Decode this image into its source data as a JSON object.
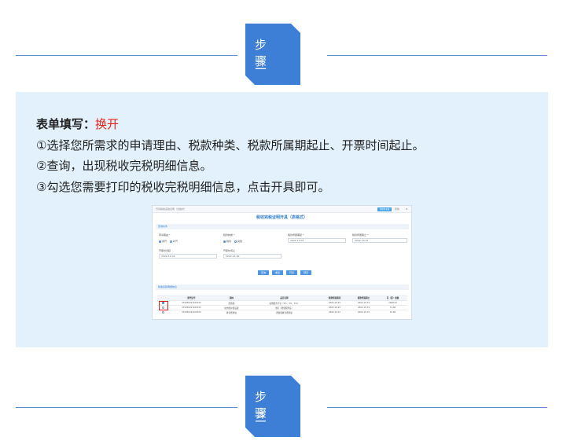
{
  "step2": {
    "label": "步 骤",
    "number": "二"
  },
  "step3": {
    "label": "步 骤",
    "number": "三"
  },
  "panel": {
    "heading": "表单填写：",
    "heading_value": "换开",
    "lines": [
      "①选择您所需求的申请理由、税款种类、税款所属期起止、开票时间起止。",
      "②查询，出现税收完税明细信息。",
      "③勾选您需要打印的税收完税明细信息，点击开具即可。"
    ]
  },
  "screenshot": {
    "breadcrumb": "开具税收完税证明（表格式）",
    "top_button": "切换到老版",
    "help": "帮助",
    "title": "税收完税证明开具（表格式）",
    "section_query": "查询条件",
    "section_result": "税收完税明细信息",
    "fields": {
      "reason": {
        "label": "申请理由 *",
        "options": [
          "换开",
          "补开"
        ]
      },
      "tax_kind": {
        "label": "税款种类 *",
        "options": [
          "税款",
          "其他"
        ]
      },
      "period_start": {
        "label": "税款所属期起 *",
        "value": "2022-10-01"
      },
      "period_end": {
        "label": "税款所属期止 *",
        "value": "2022-10-31"
      },
      "invoice_start": {
        "label": "开票时间起",
        "value": "2022-11-01"
      },
      "invoice_end": {
        "label": "开票时间止",
        "value": "2022-11-30"
      }
    },
    "buttons": [
      "查询",
      "重置",
      "开具",
      "预览"
    ],
    "table": {
      "headers": [
        "",
        "原凭证号",
        "税种",
        "品目名称",
        "税款所属期起",
        "税款所属期止",
        "实（退）金额"
      ],
      "rows": [
        [
          "",
          "331050221100472",
          "增值税",
          "其他服务行业（1%、3%、5%）",
          "2022-10-01",
          "2022-10-31",
          "1068.52"
        ],
        [
          "",
          "331050221100472",
          "城市维护建设税",
          "市区（增值税附征）",
          "2022-10-01",
          "2022-10-31",
          "74.80"
        ],
        [
          "",
          "331050221100472",
          "教育费附加",
          "增值税教育费附加",
          "2022-10-01",
          "2022-10-31",
          "32.06"
        ]
      ]
    }
  }
}
